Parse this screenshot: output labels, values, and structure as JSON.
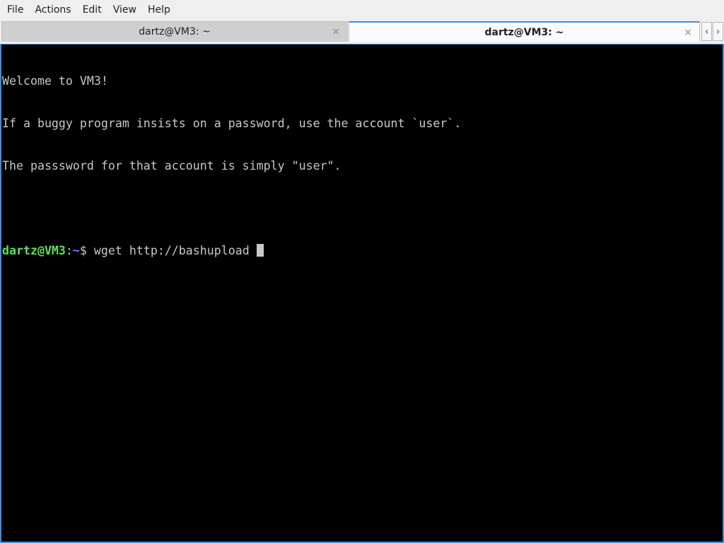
{
  "menubar": {
    "items": [
      "File",
      "Actions",
      "Edit",
      "View",
      "Help"
    ]
  },
  "tabs": [
    {
      "title": "dartz@VM3: ~",
      "active": false,
      "close": "×"
    },
    {
      "title": "dartz@VM3: ~",
      "active": true,
      "close": "×"
    }
  ],
  "tab_scroll": {
    "left": "‹",
    "right": "›"
  },
  "terminal": {
    "lines": [
      "Welcome to VM3!",
      "If a buggy program insists on a password, use the account `user`.",
      "The passsword for that account is simply \"user\".",
      ""
    ],
    "prompt": {
      "user_host": "dartz@VM3",
      "separator": ":",
      "path": "~",
      "symbol": "$",
      "command": " wget http://bashupload "
    }
  },
  "colors": {
    "accent": "#3c8edb",
    "terminal_bg": "#000000",
    "terminal_fg": "#c8c8c8",
    "prompt_user": "#5fe05f",
    "prompt_path": "#7c7cff"
  }
}
